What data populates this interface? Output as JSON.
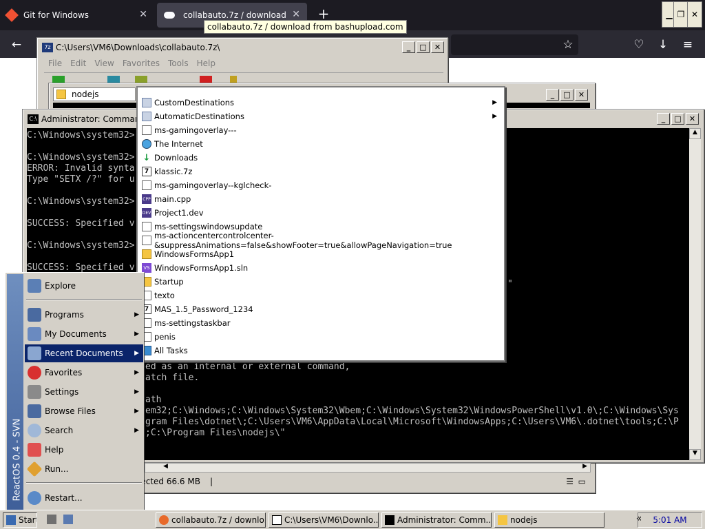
{
  "firefox": {
    "tabs": [
      {
        "title": "Git for Windows",
        "close": "✕"
      },
      {
        "title": "collabauto.7z / download from",
        "close": "✕"
      }
    ],
    "new_tab": "+",
    "tooltip": "collabauto.7z / download from bashupload.com",
    "window_controls": {
      "minimize": "▁",
      "restore": "❐",
      "close": "✕"
    },
    "nav": {
      "back": "←",
      "bookmark": "☆",
      "pocket": "♡",
      "download": "↓",
      "menu": "≡"
    }
  },
  "zip_window": {
    "title": "C:\\Users\\VM6\\Downloads\\collabauto.7z\\",
    "menu": [
      "File",
      "Edit",
      "View",
      "Favorites",
      "Tools",
      "Help"
    ]
  },
  "nodejs_window": {
    "title": "nodejs",
    "status_selected": "lected  66.6 MB"
  },
  "cmd_window": {
    "title": "Administrator: Command",
    "lines": [
      "C:\\Windows\\system32>",
      "",
      "C:\\Windows\\system32>",
      "ERROR: Invalid synta",
      "Type \"SETX /?\" for u",
      "",
      "C:\\Windows\\system32>",
      "",
      "SUCCESS: Specified v",
      "",
      "C:\\Windows\\system32>",
      "",
      "SUCCESS: Specified v"
    ],
    "lines_lower": [
      "ed as an internal or external command,",
      "atch file.",
      "",
      "ath",
      "em32;C:\\Windows;C:\\Windows\\System32\\Wbem;C:\\Windows\\System32\\WindowsPowerShell\\v1.0\\;C:\\Windows\\Sys",
      "gram Files\\dotnet\\;C:\\Users\\VM6\\AppData\\Local\\Microsoft\\WindowsApps;C:\\Users\\VM6\\.dotnet\\tools;C:\\P",
      ";C:\\Program Files\\nodejs\\\""
    ],
    "stray_quote": "\""
  },
  "recent_documents": [
    {
      "label": "CustomDestinations",
      "icon": "folder-blue",
      "submenu": true
    },
    {
      "label": "AutomaticDestinations",
      "icon": "folder-blue",
      "submenu": true
    },
    {
      "label": "ms-gamingoverlay---",
      "icon": "doc"
    },
    {
      "label": "The Internet",
      "icon": "web"
    },
    {
      "label": "Downloads",
      "icon": "download"
    },
    {
      "label": "klassic.7z",
      "icon": "7z"
    },
    {
      "label": "ms-gamingoverlay--kglcheck-",
      "icon": "doc"
    },
    {
      "label": "main.cpp",
      "icon": "cpp"
    },
    {
      "label": "Project1.dev",
      "icon": "cpp"
    },
    {
      "label": "ms-settingswindowsupdate",
      "icon": "doc"
    },
    {
      "label": "ms-actioncentercontrolcenter-&suppressAnimations=false&showFooter=true&allowPageNavigation=true",
      "icon": "doc"
    },
    {
      "label": "WindowsFormsApp1",
      "icon": "folder"
    },
    {
      "label": "WindowsFormsApp1.sln",
      "icon": "sln"
    },
    {
      "label": "Startup",
      "icon": "folder"
    },
    {
      "label": "texto",
      "icon": "doc"
    },
    {
      "label": "MAS_1.5_Password_1234",
      "icon": "7z"
    },
    {
      "label": "ms-settingstaskbar",
      "icon": "doc"
    },
    {
      "label": "penis",
      "icon": "doc"
    },
    {
      "label": "All Tasks",
      "icon": "tasks"
    }
  ],
  "start_menu": {
    "side_text": "ReactOS  0.4 - SVN",
    "items": [
      {
        "label": "Explore",
        "submenu": false
      },
      {
        "label": "Programs",
        "submenu": true
      },
      {
        "label": "My Documents",
        "submenu": true
      },
      {
        "label": "Recent Documents",
        "submenu": true
      },
      {
        "label": "Favorites",
        "submenu": true
      },
      {
        "label": "Settings",
        "submenu": true
      },
      {
        "label": "Browse Files",
        "submenu": true
      },
      {
        "label": "Search",
        "submenu": true
      },
      {
        "label": "Help",
        "submenu": false
      },
      {
        "label": "Run...",
        "submenu": false
      },
      {
        "label": "Restart...",
        "submenu": false
      }
    ]
  },
  "taskbar": {
    "start": "Start",
    "buttons": [
      "collabauto.7z / downlo...",
      "C:\\Users\\VM6\\Downlo...",
      "Administrator: Comm...",
      "nodejs"
    ],
    "tray_toggle": "«",
    "clock": "5:01 AM"
  }
}
